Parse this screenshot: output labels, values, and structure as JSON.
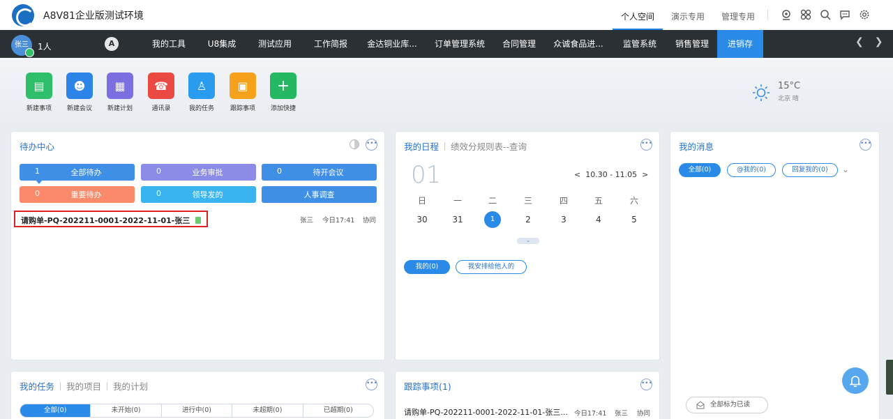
{
  "app": {
    "title": "A8V81企业版测试环境"
  },
  "top_tabs": [
    {
      "label": "个人空间",
      "active": true
    },
    {
      "label": "演示专用",
      "active": false
    },
    {
      "label": "管理专用",
      "active": false
    }
  ],
  "top_icons": [
    "webcam-icon",
    "apps-grid-icon",
    "search-icon",
    "chat-icon",
    "gear-icon"
  ],
  "user": {
    "avatar_text": "张三",
    "count": "1人"
  },
  "nav": {
    "home_glyph": "A",
    "items": [
      {
        "label": "我的工具"
      },
      {
        "label": "U8集成"
      },
      {
        "label": "测试应用"
      },
      {
        "label": "工作简报"
      },
      {
        "label": "金达铜业库..."
      },
      {
        "label": "订单管理系统"
      },
      {
        "label": "合同管理"
      },
      {
        "label": "众诚食品进..."
      },
      {
        "label": "监管系统"
      },
      {
        "label": "销售管理"
      },
      {
        "label": "进销存",
        "active": true
      }
    ]
  },
  "quick_actions": [
    {
      "label": "新建事项",
      "color": "#2fbf6b",
      "icon": "new-matter-icon",
      "glyph": "▤"
    },
    {
      "label": "新建会议",
      "color": "#2c84e8",
      "icon": "meeting-icon",
      "glyph": "☻"
    },
    {
      "label": "新建计划",
      "color": "#7a6ee0",
      "icon": "plan-icon",
      "glyph": "▦"
    },
    {
      "label": "通讯录",
      "color": "#ea4a42",
      "icon": "contacts-icon",
      "glyph": "☎"
    },
    {
      "label": "我的任务",
      "color": "#2a9bef",
      "icon": "task-icon",
      "glyph": "♙"
    },
    {
      "label": "跟踪事项",
      "color": "#f5a11c",
      "icon": "track-icon",
      "glyph": "▣"
    },
    {
      "label": "添加快捷",
      "color": "#24b863",
      "icon": "add-icon",
      "glyph": "+"
    }
  ],
  "weather": {
    "temp": "15°C",
    "city": "北京 晴"
  },
  "todo": {
    "title": "待办中心",
    "buttons": [
      {
        "count": "1",
        "label": "全部待办",
        "color": "#3f8fe6"
      },
      {
        "count": "0",
        "label": "业务审批",
        "color": "#8c8ce8"
      },
      {
        "count": "0",
        "label": "待开会议",
        "color": "#3f8fe6"
      },
      {
        "count": "0",
        "label": "重要待办",
        "color": "#fb8a6a"
      },
      {
        "count": "0",
        "label": "领导发的",
        "color": "#39b4f1"
      },
      {
        "count": "",
        "label": "人事调查",
        "color": "#3f8fe6"
      }
    ],
    "item": {
      "title": "请购单-PQ-202211-0001-2022-11-01-张三",
      "sender": "张三",
      "time": "今日17:41",
      "type": "协同"
    }
  },
  "schedule": {
    "tab_active": "我的日程",
    "tab_other": "绩效分规则表--查询",
    "day": "01",
    "range": "10.30 - 11.05",
    "weekdays": [
      "日",
      "一",
      "二",
      "三",
      "四",
      "五",
      "六"
    ],
    "days": [
      "30",
      "31",
      "1",
      "2",
      "3",
      "4",
      "5"
    ],
    "pill_mine": "我的(0)",
    "pill_assigned": "我安排给他人的"
  },
  "messages": {
    "title": "我的消息",
    "pills": [
      "全部(0)",
      "@我的(0)",
      "回复我的(0)"
    ],
    "mark_all": "全部标为已读"
  },
  "tasks": {
    "tabs": [
      "我的任务",
      "我的项目",
      "我的计划"
    ],
    "segments": [
      "全部(0)",
      "未开始(0)",
      "进行中(0)",
      "未超期(0)",
      "已超期(0)"
    ]
  },
  "tracking": {
    "title": "跟踪事项(1)",
    "item": {
      "title": "请购单-PQ-202211-0001-2022-11-01-张三...",
      "time": "今日17:41",
      "sender": "张三",
      "type": "协同"
    }
  }
}
